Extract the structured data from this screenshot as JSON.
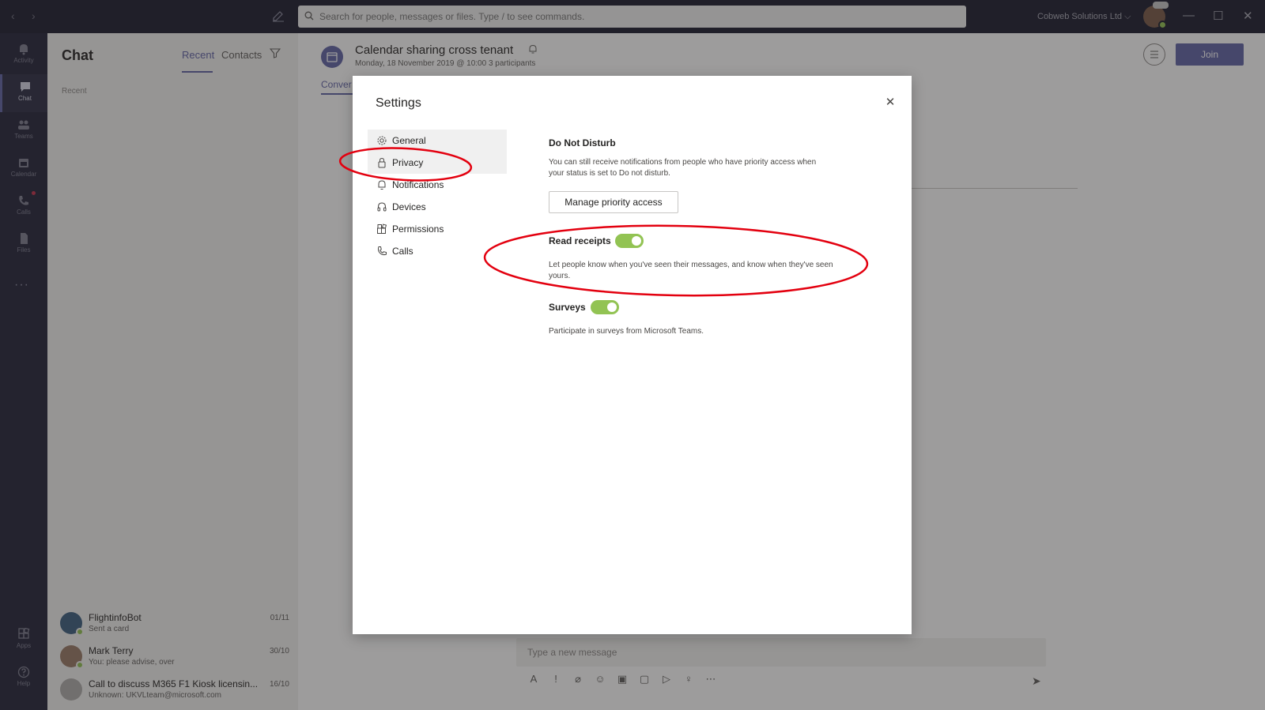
{
  "topbar": {
    "search_placeholder": "Search for people, messages or files. Type / to see commands.",
    "org_name": "Cobweb Solutions Ltd",
    "org_chevron": "⌵",
    "back": "‹",
    "forward": "›",
    "minimize": "—",
    "maximize": "☐",
    "close": "✕"
  },
  "rail": {
    "items": [
      {
        "label": "Activity"
      },
      {
        "label": "Chat"
      },
      {
        "label": "Teams"
      },
      {
        "label": "Calendar"
      },
      {
        "label": "Calls"
      },
      {
        "label": "Files"
      },
      {
        "label": "Apps"
      },
      {
        "label": "Help"
      }
    ],
    "more": "···"
  },
  "chatlist": {
    "title": "Chat",
    "tab_recent": "Recent",
    "tab_contacts": "Contacts",
    "recent_label": "Recent",
    "items": [
      {
        "name": "FlightinfoBot",
        "sub": "Sent a card",
        "date": "01/11"
      },
      {
        "name": "Mark Terry",
        "sub": "You: please advise, over",
        "date": "30/10"
      },
      {
        "name": "Call to discuss M365 F1 Kiosk licensin...",
        "sub": "Unknown: UKVLteam@microsoft.com",
        "date": "16/10"
      }
    ]
  },
  "meeting": {
    "title": "Calendar sharing cross tenant",
    "subtitle": "Monday, 18 November 2019 @ 10:00 3 participants",
    "tab": "Conver",
    "join_label": "Join",
    "compose_placeholder": "Type a new message"
  },
  "settings": {
    "title": "Settings",
    "close": "✕",
    "menu": [
      {
        "label": "General"
      },
      {
        "label": "Privacy"
      },
      {
        "label": "Notifications"
      },
      {
        "label": "Devices"
      },
      {
        "label": "Permissions"
      },
      {
        "label": "Calls"
      }
    ],
    "dnd_title": "Do Not Disturb",
    "dnd_desc": "You can still receive notifications from people who have priority access when your status is set to Do not disturb.",
    "manage_btn": "Manage priority access",
    "read_title": "Read receipts",
    "read_on": true,
    "read_desc": "Let people know when you've seen their messages, and know when they've seen yours.",
    "surveys_title": "Surveys",
    "surveys_on": true,
    "surveys_desc": "Participate in surveys from Microsoft Teams."
  },
  "colors": {
    "accent": "#6264a7",
    "toggle_on": "#92c353",
    "annotation": "#e3000f"
  }
}
